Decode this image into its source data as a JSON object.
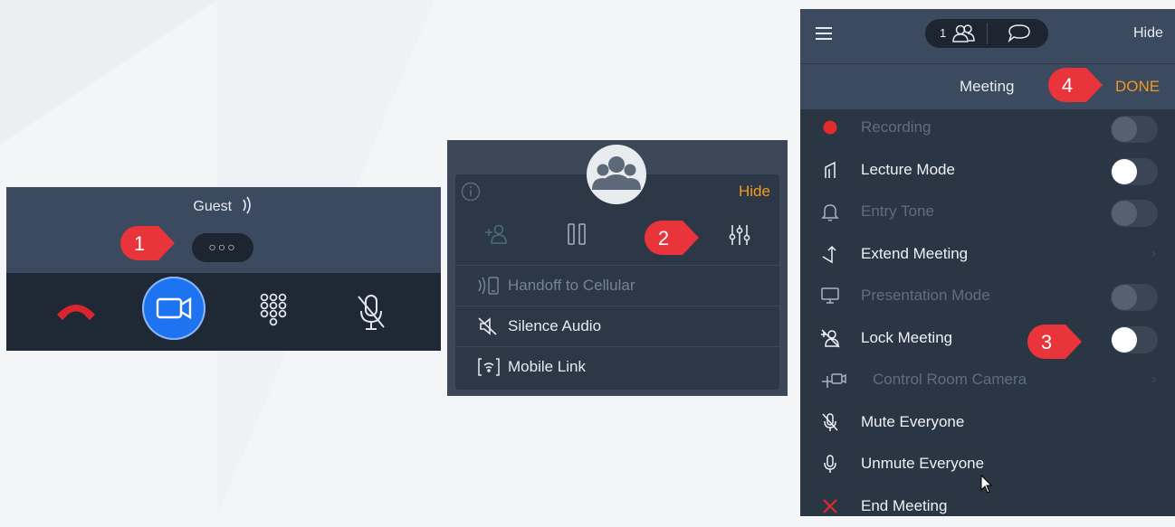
{
  "panel1": {
    "caller_label": "Guest",
    "more_button": "○○○"
  },
  "panel2": {
    "hide": "Hide",
    "menu": [
      {
        "label": "Handoff to Cellular",
        "icon": "handoff-icon",
        "enabled": false
      },
      {
        "label": "Silence Audio",
        "icon": "speaker-muted-icon",
        "enabled": true
      },
      {
        "label": "Mobile Link",
        "icon": "mobile-link-icon",
        "enabled": true
      }
    ]
  },
  "panel3": {
    "participants_count": "1",
    "hide": "Hide",
    "title": "Meeting",
    "done": "DONE",
    "items": [
      {
        "label": "Recording",
        "enabled": false,
        "control": "toggle",
        "on": false,
        "icon": "record-dot-icon"
      },
      {
        "label": "Lecture Mode",
        "enabled": true,
        "control": "toggle",
        "on": true,
        "icon": "lecture-icon"
      },
      {
        "label": "Entry Tone",
        "enabled": false,
        "control": "toggle",
        "on": false,
        "icon": "bell-icon"
      },
      {
        "label": "Extend Meeting",
        "enabled": true,
        "control": "chevron",
        "icon": "extend-icon"
      },
      {
        "label": "Presentation Mode",
        "enabled": false,
        "control": "toggle",
        "on": false,
        "icon": "monitor-icon"
      },
      {
        "label": "Lock Meeting",
        "enabled": true,
        "control": "toggle",
        "on": true,
        "icon": "lock-participant-icon"
      },
      {
        "label": "Control Room Camera",
        "enabled": false,
        "control": "chevron",
        "icon": "camera-move-icon"
      },
      {
        "label": "Mute Everyone",
        "enabled": true,
        "control": "none",
        "icon": "mic-muted-icon"
      },
      {
        "label": "Unmute Everyone",
        "enabled": true,
        "control": "none",
        "icon": "mic-icon"
      },
      {
        "label": "End Meeting",
        "enabled": true,
        "control": "none",
        "icon": "close-red-icon"
      }
    ]
  },
  "callouts": [
    "1",
    "2",
    "3",
    "4"
  ],
  "colors": {
    "accent_orange": "#f29a1f",
    "video_blue": "#1e73f0",
    "end_call_red": "#d9252b",
    "callout_red": "#e8343a"
  }
}
